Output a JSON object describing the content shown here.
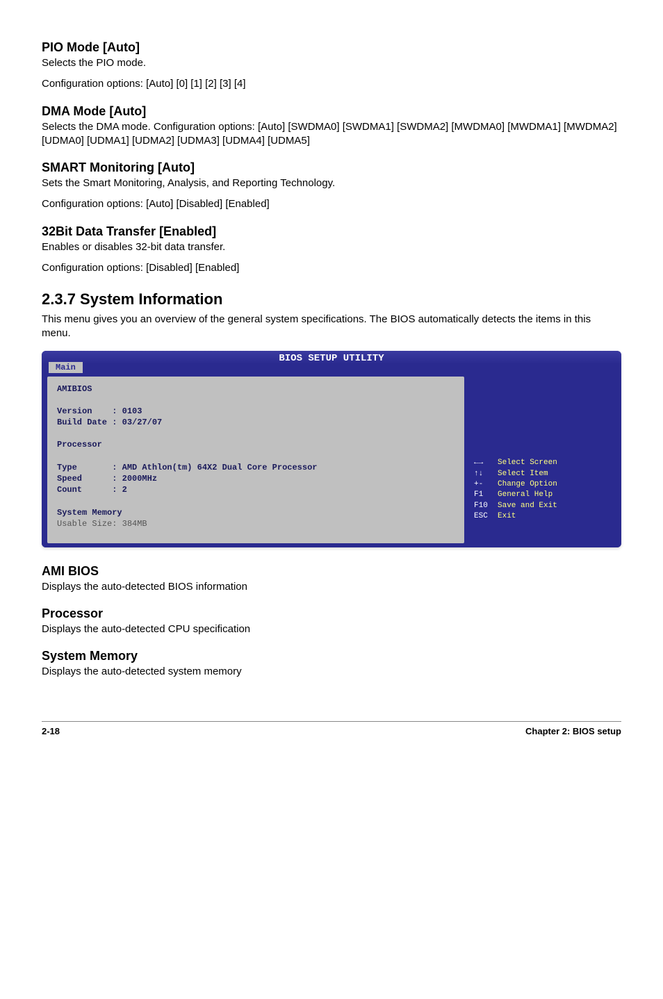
{
  "sections": {
    "pio": {
      "title": "PIO Mode [Auto]",
      "line1": "Selects the PIO mode.",
      "line2": "Configuration options: [Auto] [0] [1] [2] [3] [4]"
    },
    "dma": {
      "title": "DMA Mode [Auto]",
      "text": "Selects the DMA mode. Configuration options: [Auto] [SWDMA0] [SWDMA1] [SWDMA2] [MWDMA0] [MWDMA1] [MWDMA2] [UDMA0] [UDMA1] [UDMA2] [UDMA3] [UDMA4] [UDMA5]"
    },
    "smart": {
      "title": "SMART Monitoring [Auto]",
      "line1": "Sets the Smart Monitoring, Analysis, and Reporting Technology.",
      "line2": "Configuration options: [Auto] [Disabled] [Enabled]"
    },
    "transfer": {
      "title": "32Bit Data Transfer [Enabled]",
      "line1": "Enables or disables 32-bit data transfer.",
      "line2": "Configuration options: [Disabled] [Enabled]"
    },
    "sysinfo": {
      "title": "2.3.7   System Information",
      "text": "This menu gives you an overview of the general system specifications. The BIOS automatically detects the items in this menu."
    },
    "amibios": {
      "title": "AMI BIOS",
      "text": "Displays the auto-detected BIOS information"
    },
    "processor": {
      "title": "Processor",
      "text": "Displays the auto-detected CPU specification"
    },
    "sysmem": {
      "title": "System Memory",
      "text": "Displays the auto-detected system memory"
    }
  },
  "bios": {
    "header": "BIOS SETUP UTILITY",
    "tab": "Main",
    "left": {
      "amibios": "AMIBIOS",
      "version_label": "Version    :",
      "version_value": "0103",
      "builddate_label": "Build Date :",
      "builddate_value": "03/27/07",
      "processor": "Processor",
      "type_label": "Type       :",
      "type_value": "AMD Athlon(tm) 64X2 Dual Core Processor",
      "speed_label": "Speed      :",
      "speed_value": "2000MHz",
      "count_label": "Count      :",
      "count_value": "2",
      "sysmem": "System Memory",
      "usable_label": "Usable Size:",
      "usable_value": "384MB"
    },
    "right": {
      "k1": "←→",
      "v1": "Select Screen",
      "k2": "↑↓",
      "v2": "Select Item",
      "k3": "+-",
      "v3": "Change Option",
      "k4": "F1",
      "v4": "General Help",
      "k5": "F10",
      "v5": "Save and Exit",
      "k6": "ESC",
      "v6": "Exit"
    }
  },
  "footer": {
    "left": "2-18",
    "right": "Chapter 2: BIOS setup"
  }
}
